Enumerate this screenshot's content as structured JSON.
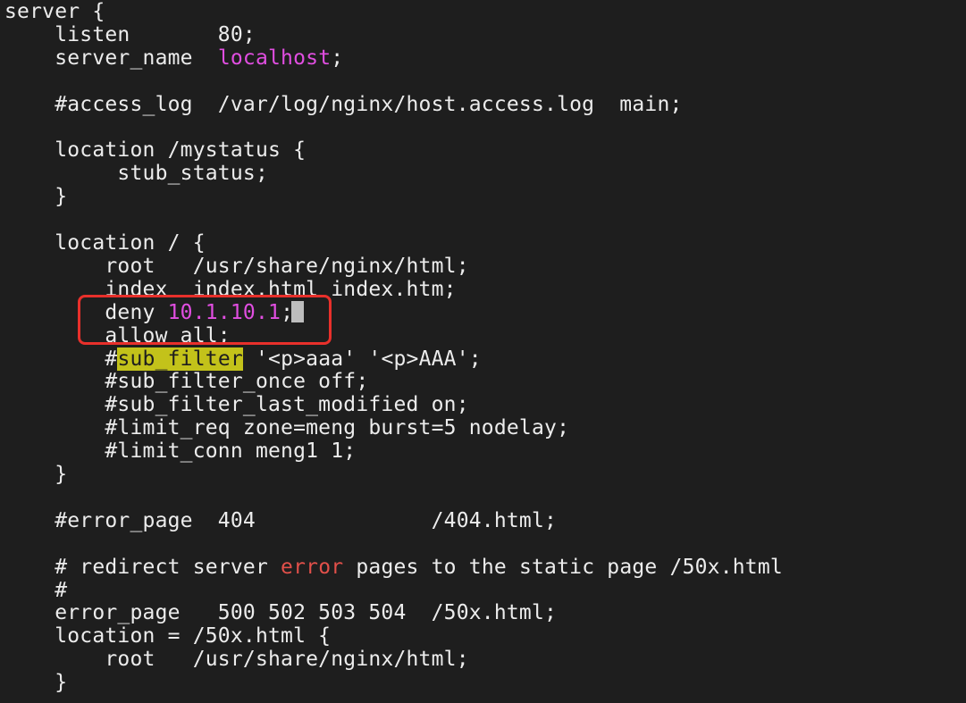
{
  "colors": {
    "background": "#1e1e1e",
    "text": "#ececec",
    "magenta": "#e14ee1",
    "red": "#e2504a",
    "highlight": "#c3c21a",
    "annotation_box": "#e8302b"
  },
  "lines": [
    {
      "segments": [
        {
          "t": "server {",
          "c": "normal"
        }
      ]
    },
    {
      "segments": [
        {
          "t": "    listen       80;",
          "c": "normal"
        }
      ]
    },
    {
      "segments": [
        {
          "t": "    server_name  ",
          "c": "normal"
        },
        {
          "t": "localhost",
          "c": "magenta"
        },
        {
          "t": ";",
          "c": "normal"
        }
      ]
    },
    {
      "segments": [
        {
          "t": "",
          "c": "normal"
        }
      ]
    },
    {
      "segments": [
        {
          "t": "    #access_log  /var/log/nginx/host.access.log  main;",
          "c": "normal"
        }
      ]
    },
    {
      "segments": [
        {
          "t": "",
          "c": "normal"
        }
      ]
    },
    {
      "segments": [
        {
          "t": "    location /mystatus {",
          "c": "normal"
        }
      ]
    },
    {
      "segments": [
        {
          "t": "         stub_status;",
          "c": "normal"
        }
      ]
    },
    {
      "segments": [
        {
          "t": "    }",
          "c": "normal"
        }
      ]
    },
    {
      "segments": [
        {
          "t": "",
          "c": "normal"
        }
      ]
    },
    {
      "segments": [
        {
          "t": "    location / {",
          "c": "normal"
        }
      ]
    },
    {
      "segments": [
        {
          "t": "        root   /usr/share/nginx/html;",
          "c": "normal"
        }
      ]
    },
    {
      "segments": [
        {
          "t": "        index  index.html index.htm;",
          "c": "normal"
        }
      ]
    },
    {
      "segments": [
        {
          "t": "        deny ",
          "c": "normal"
        },
        {
          "t": "10.1.10.1",
          "c": "magenta"
        },
        {
          "t": ";",
          "c": "normal"
        }
      ]
    },
    {
      "segments": [
        {
          "t": "        allow all;",
          "c": "normal"
        }
      ]
    },
    {
      "segments": [
        {
          "t": "        #",
          "c": "normal"
        },
        {
          "t": "sub_filter",
          "c": "highlight"
        },
        {
          "t": " '<p>aaa' '<p>AAA';",
          "c": "normal"
        }
      ]
    },
    {
      "segments": [
        {
          "t": "        #sub_filter_once off;",
          "c": "normal"
        }
      ]
    },
    {
      "segments": [
        {
          "t": "        #sub_filter_last_modified on;",
          "c": "normal"
        }
      ]
    },
    {
      "segments": [
        {
          "t": "        #limit_req zone=meng burst=5 nodelay;",
          "c": "normal"
        }
      ]
    },
    {
      "segments": [
        {
          "t": "        #limit_conn meng1 1;",
          "c": "normal"
        }
      ]
    },
    {
      "segments": [
        {
          "t": "    }",
          "c": "normal"
        }
      ]
    },
    {
      "segments": [
        {
          "t": "",
          "c": "normal"
        }
      ]
    },
    {
      "segments": [
        {
          "t": "    #error_page  404              /404.html;",
          "c": "normal"
        }
      ]
    },
    {
      "segments": [
        {
          "t": "",
          "c": "normal"
        }
      ]
    },
    {
      "segments": [
        {
          "t": "    # redirect server ",
          "c": "normal"
        },
        {
          "t": "error",
          "c": "red"
        },
        {
          "t": " pages to the static page /50x.html",
          "c": "normal"
        }
      ]
    },
    {
      "segments": [
        {
          "t": "    #",
          "c": "normal"
        }
      ]
    },
    {
      "segments": [
        {
          "t": "    error_page   500 502 503 504  /50x.html;",
          "c": "normal"
        }
      ]
    },
    {
      "segments": [
        {
          "t": "    location = /50x.html {",
          "c": "normal"
        }
      ]
    },
    {
      "segments": [
        {
          "t": "        root   /usr/share/nginx/html;",
          "c": "normal"
        }
      ]
    },
    {
      "segments": [
        {
          "t": "    }",
          "c": "normal"
        }
      ]
    }
  ]
}
